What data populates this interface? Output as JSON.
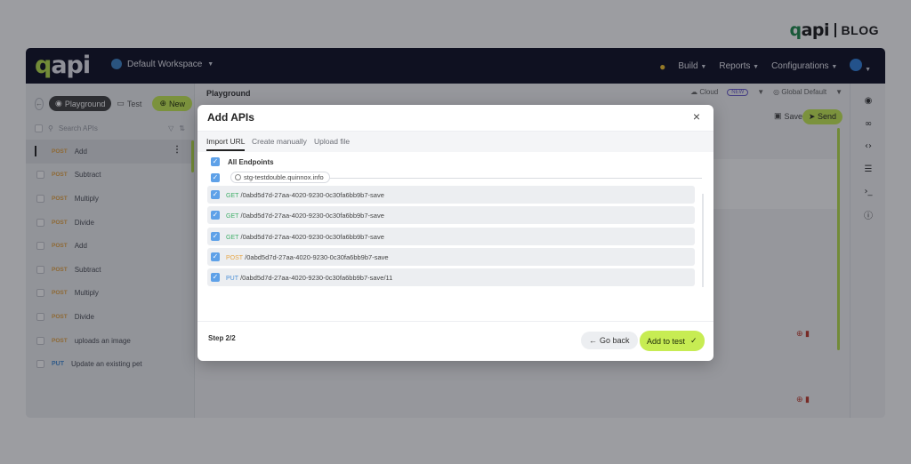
{
  "brand": {
    "logo": "qapi",
    "blog": "BLOG"
  },
  "topbar": {
    "logo": "qapi",
    "workspace": "Default Workspace",
    "nav": [
      "Build",
      "Reports",
      "Configurations"
    ]
  },
  "sidebar": {
    "tabs": {
      "playground": "Playground",
      "test": "Test",
      "new": "New"
    },
    "search_placeholder": "Search APIs",
    "items": [
      {
        "method": "POST",
        "label": "Add"
      },
      {
        "method": "POST",
        "label": "Subtract"
      },
      {
        "method": "POST",
        "label": "Multiply"
      },
      {
        "method": "POST",
        "label": "Divide"
      },
      {
        "method": "POST",
        "label": "Add"
      },
      {
        "method": "POST",
        "label": "Subtract"
      },
      {
        "method": "POST",
        "label": "Multiply"
      },
      {
        "method": "POST",
        "label": "Divide"
      },
      {
        "method": "POST",
        "label": "uploads an image"
      },
      {
        "method": "PUT",
        "label": "Update an existing pet"
      }
    ]
  },
  "main": {
    "title": "Playground",
    "env": "Cloud",
    "new_badge": "NEW",
    "global": "Global Default",
    "save": "Save",
    "send": "Send"
  },
  "modal": {
    "title": "Add APIs",
    "tabs": [
      "Import URL",
      "Create manually",
      "Upload file"
    ],
    "all_endpoints": "All Endpoints",
    "host": "stg-testdouble.quinnox.info",
    "endpoints": [
      {
        "method": "GET",
        "path": "/0abd5d7d-27aa-4020-9230-0c30fa6bb9b7-save"
      },
      {
        "method": "GET",
        "path": "/0abd5d7d-27aa-4020-9230-0c30fa6bb9b7-save"
      },
      {
        "method": "GET",
        "path": "/0abd5d7d-27aa-4020-9230-0c30fa6bb9b7-save"
      },
      {
        "method": "POST",
        "path": "/0abd5d7d-27aa-4020-9230-0c30fa6bb9b7-save"
      },
      {
        "method": "PUT",
        "path": "/0abd5d7d-27aa-4020-9230-0c30fa6bb9b7-save/11"
      }
    ],
    "step": "Step 2/2",
    "go_back": "Go back",
    "add_to_test": "Add to test"
  },
  "colors": {
    "accent": "#c7ec53",
    "topbar": "#0d0f24",
    "checkbox": "#5ea1e8",
    "get": "#3fae68",
    "post": "#e7a646",
    "put": "#4a8fd6"
  }
}
